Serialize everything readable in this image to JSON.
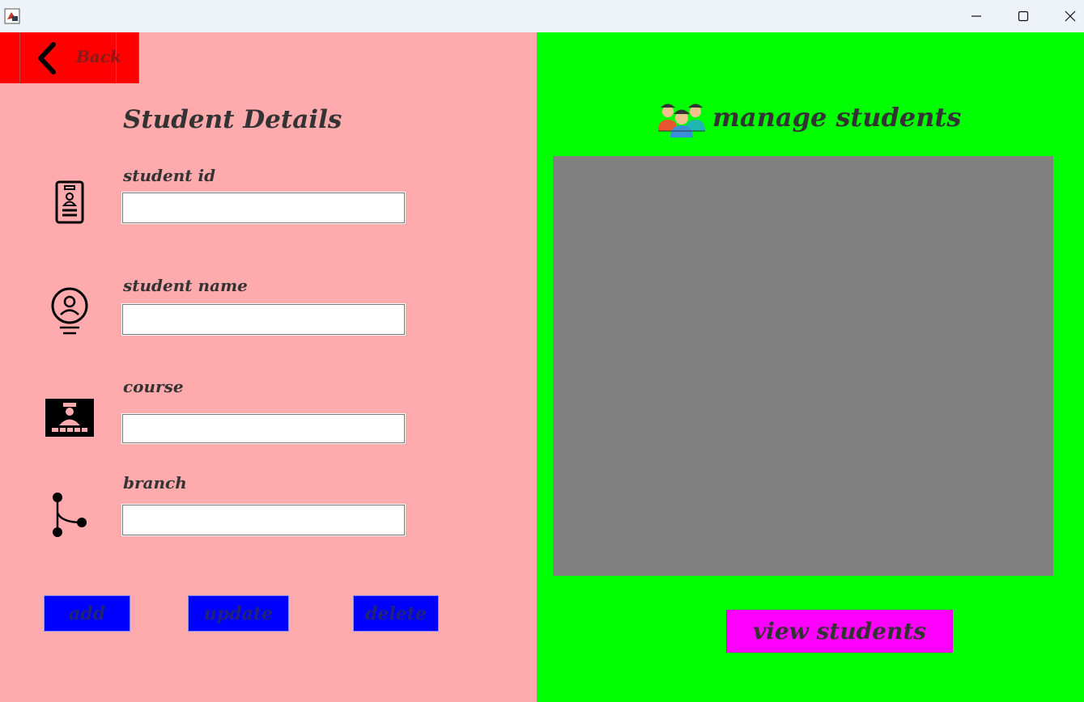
{
  "window": {
    "icons": {
      "app": "java-app-icon",
      "minimize": "minimize-icon",
      "maximize": "maximize-icon",
      "close": "close-icon"
    }
  },
  "left_panel": {
    "back_label": "Back",
    "title": "Student Details",
    "fields": [
      {
        "label": "student id",
        "value": "",
        "icon": "id-badge-icon"
      },
      {
        "label": "student name",
        "value": "",
        "icon": "user-profile-icon"
      },
      {
        "label": "course",
        "value": "",
        "icon": "graduate-card-icon"
      },
      {
        "label": "branch",
        "value": "",
        "icon": "branch-icon"
      }
    ],
    "buttons": {
      "add": "add",
      "update": "update",
      "delete": "delete"
    }
  },
  "right_panel": {
    "title": "manage students",
    "icon": "students-group-icon",
    "view_button": "view students"
  },
  "colors": {
    "left_bg": "#ffabae",
    "right_bg": "#00ff00",
    "back_button": "#ff0000",
    "action_button": "#0000ff",
    "view_button": "#ff00ff",
    "table_bg": "#808080"
  }
}
